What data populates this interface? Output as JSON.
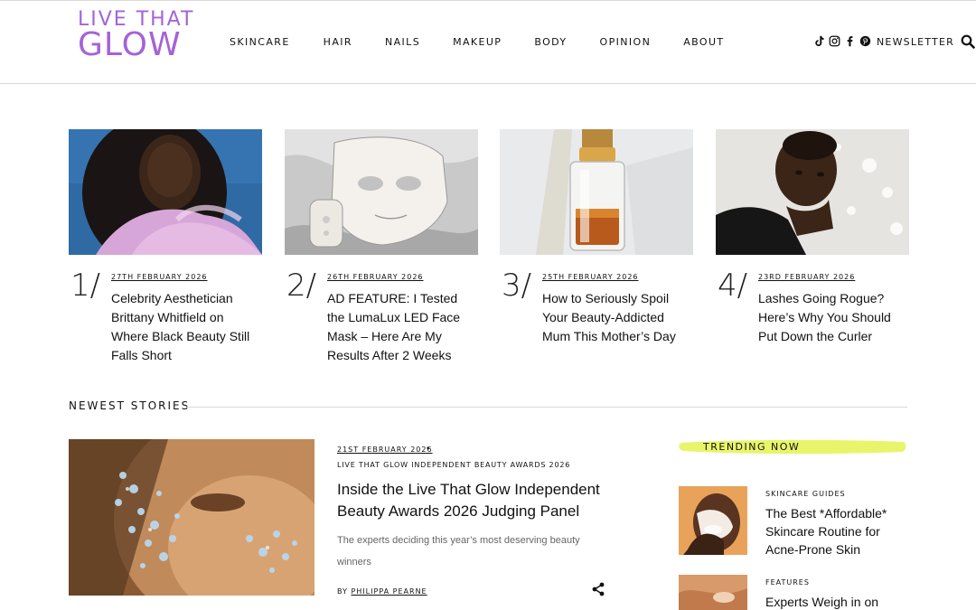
{
  "logo": {
    "line1": "LIVE THAT",
    "line2": "GLOW"
  },
  "nav": [
    "SKINCARE",
    "HAIR",
    "NAILS",
    "MAKEUP",
    "BODY",
    "OPINION",
    "ABOUT"
  ],
  "header_right": {
    "newsletter": "NEWSLETTER"
  },
  "featured": [
    {
      "num": "1/",
      "date": "27TH FEBRUARY 2026",
      "title": "Celebrity Aesthetician Brittany Whitfield on Where Black Beauty Still Falls Short"
    },
    {
      "num": "2/",
      "date": "26TH FEBRUARY 2026",
      "title": "AD FEATURE: I Tested the LumaLux LED Face Mask – Here Are My Results After 2 Weeks"
    },
    {
      "num": "3/",
      "date": "25TH FEBRUARY 2026",
      "title": "How to Seriously Spoil Your Beauty-Addicted Mum This Mother’s Day"
    },
    {
      "num": "4/",
      "date": "23RD FEBRUARY 2026",
      "title": "Lashes Going Rogue? Here’s Why You Should Put Down the Curler"
    }
  ],
  "newest": {
    "heading": "NEWEST STORIES",
    "story": {
      "date": "21ST FEBRUARY 2026",
      "category": "LIVE THAT GLOW INDEPENDENT BEAUTY AWARDS 2026",
      "title": "Inside the Live That Glow Independent Beauty Awards 2026 Judging Panel",
      "excerpt": "The experts deciding this year’s most deserving beauty winners",
      "by_prefix": "BY",
      "author": "PHILIPPA PEARNE"
    }
  },
  "trending": {
    "label": "TRENDING NOW",
    "items": [
      {
        "category": "SKINCARE GUIDES",
        "title": "The Best *Affordable* Skincare Routine for Acne-Prone Skin"
      },
      {
        "category": "FEATURES",
        "title": "Experts Weigh in on These"
      }
    ]
  },
  "colors": {
    "brand": "#a463d8",
    "highlight": "#e8f56a"
  }
}
